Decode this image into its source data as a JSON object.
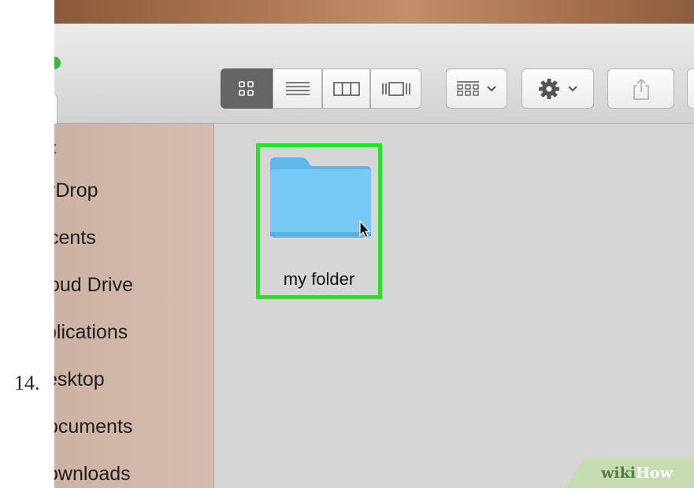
{
  "step": {
    "number": "14."
  },
  "toolbar": {
    "view_buttons": [
      {
        "name": "icon-view-button",
        "icon": "grid-icon",
        "active": true
      },
      {
        "name": "list-view-button",
        "icon": "list-icon",
        "active": false
      },
      {
        "name": "column-view-button",
        "icon": "columns-icon",
        "active": false
      },
      {
        "name": "gallery-view-button",
        "icon": "cover-flow-icon",
        "active": false
      }
    ],
    "group_button": {
      "icon": "group-icon",
      "chevron": "chevron-down-icon"
    },
    "action_button": {
      "icon": "gear-icon",
      "chevron": "chevron-down-icon"
    },
    "share_button": {
      "icon": "share-icon"
    }
  },
  "sidebar": {
    "items": [
      {
        "label": "rDrop"
      },
      {
        "label": "cents"
      },
      {
        "label": "oud Drive"
      },
      {
        "label": "plications"
      },
      {
        "label": "esktop"
      },
      {
        "label": "ocuments"
      },
      {
        "label": "ownloads"
      }
    ]
  },
  "content": {
    "folder": {
      "name": "my folder",
      "selected": true,
      "highlight_color": "#27e327",
      "folder_color": "#6cc5f4"
    }
  },
  "watermark": {
    "part1": "wiki",
    "part2": "How"
  }
}
